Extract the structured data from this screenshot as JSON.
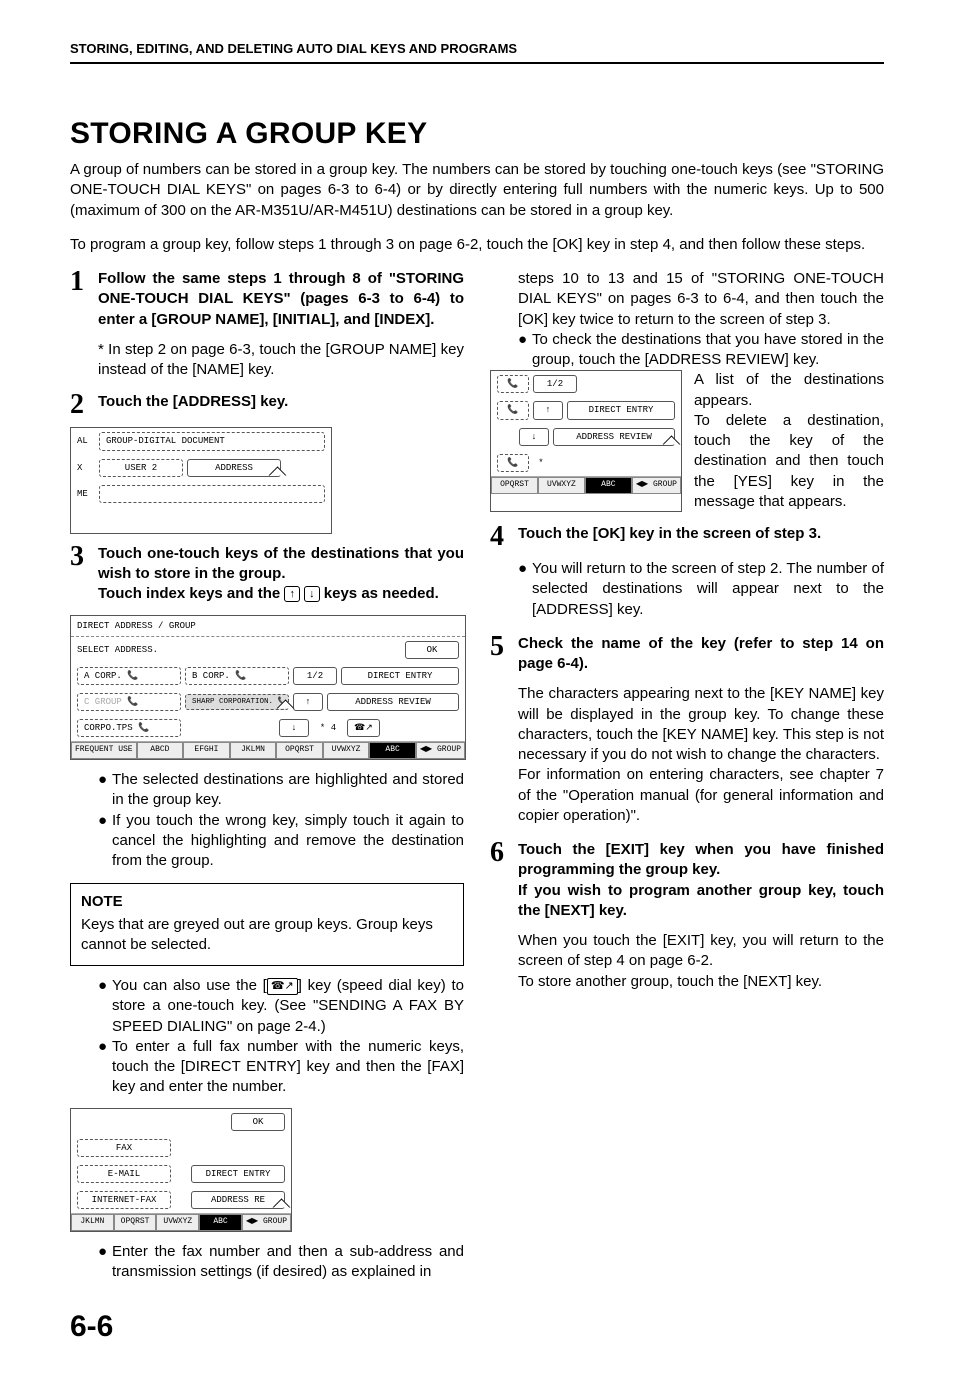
{
  "header": "STORING, EDITING, AND DELETING AUTO DIAL KEYS AND PROGRAMS",
  "title": "STORING A GROUP KEY",
  "intro": "A group of numbers can be stored in a group key. The numbers can be stored by touching one-touch keys (see \"STORING ONE-TOUCH DIAL KEYS\" on pages 6-3 to 6-4) or by directly entering full numbers with the numeric keys. Up to 500 (maximum of 300 on the AR-M351U/AR-M451U) destinations can be stored in a group key.",
  "intro2": "To program a group key, follow steps 1 through 3 on page 6-2, touch the [OK] key in step 4, and then follow these steps.",
  "step1": {
    "head": "Follow the same steps 1 through 8 of \"STORING ONE-TOUCH DIAL KEYS\" (pages 6-3 to 6-4) to enter a [GROUP NAME], [INITIAL], and [INDEX].",
    "sub": "* In step 2 on page 6-3, touch the [GROUP NAME] key instead of the [NAME] key."
  },
  "step2": {
    "head": "Touch the [ADDRESS] key.",
    "screen": {
      "row1_label": "AL",
      "row1_val": "GROUP-DIGITAL DOCUMENT",
      "row2_label": "X",
      "row2_a": "USER 2",
      "row2_b": "ADDRESS",
      "row3_label": "ME"
    }
  },
  "step3": {
    "head1": "Touch one-touch keys of the destinations that you wish to store in the group.",
    "head2_a": "Touch index keys and the ",
    "head2_b": " keys as needed.",
    "screen": {
      "top": "DIRECT ADDRESS / GROUP",
      "select": "SELECT ADDRESS.",
      "ok": "OK",
      "a_corp": "A CORP.",
      "b_corp": "B CORP.",
      "page": "1/2",
      "direct_entry": "DIRECT ENTRY",
      "c_group": "C GROUP",
      "sharp": "SHARP CORPORATION.",
      "address_review": "ADDRESS REVIEW",
      "corpo": "CORPO.TPS",
      "star4": "*  4",
      "tabs": [
        "FREQUENT USE",
        "ABCD",
        "EFGHI",
        "JKLMN",
        "OPQRST",
        "UVWXYZ",
        "ABC",
        "GROUP"
      ]
    },
    "b1": "The selected destinations are highlighted and stored in the group key.",
    "b2": "If you touch the wrong key, simply touch it again to cancel the highlighting and remove the destination from the group."
  },
  "note": {
    "title": "NOTE",
    "body": "Keys that are greyed out are group keys. Group keys cannot be selected.",
    "b1_a": "You can also use the [",
    "b1_b": "] key (speed dial key) to store a one-touch key. (See \"SENDING A FAX BY SPEED DIALING\" on page 2-4.)",
    "b2": "To enter a full fax number with the numeric keys, touch the [DIRECT ENTRY] key and then the [FAX] key and enter the number.",
    "screen": {
      "ok": "OK",
      "fax": "FAX",
      "email": "E-MAIL",
      "direct_entry": "DIRECT ENTRY",
      "ifax": "INTERNET-FAX",
      "address_re": "ADDRESS RE",
      "tabs": [
        "JKLMN",
        "OPQRST",
        "UVWXYZ",
        "ABC",
        "GROUP"
      ]
    },
    "b3": "Enter the fax number and then a sub-address and transmission settings (if desired) as explained in"
  },
  "right": {
    "cont1": "steps 10 to 13 and 15 of \"STORING ONE-TOUCH DIAL KEYS\" on pages 6-3 to 6-4, and then touch the [OK] key twice to return to the screen of step 3.",
    "cont2": "To check the destinations that you have stored in the group, touch the [ADDRESS REVIEW] key.",
    "fig": {
      "page": "1/2",
      "direct_entry": "DIRECT ENTRY",
      "address_review": "ADDRESS REVIEW",
      "tabs": [
        "OPQRST",
        "UVWXYZ",
        "ABC",
        "GROUP"
      ]
    },
    "figtext1": "A list of the destinations appears.",
    "figtext2": "To delete a destination, touch the key of the destination and then touch the [YES] key in the message that appears."
  },
  "step4": {
    "head": "Touch the [OK] key in the screen of step 3.",
    "b1": "You will return to the screen of step 2. The number of selected destinations will appear next to the [ADDRESS] key."
  },
  "step5": {
    "head": "Check the name of the key (refer to step 14 on page 6-4).",
    "p1": "The characters appearing next to the [KEY NAME] key will be displayed in the group key. To change these characters, touch the [KEY NAME] key. This step is not necessary if you do not wish to change the characters.",
    "p2": "For information on entering characters, see chapter 7 of the \"Operation manual (for general information and copier operation)\"."
  },
  "step6": {
    "head": "Touch the [EXIT] key when you have finished programming the group key.\nIf you wish to program another group key, touch the [NEXT] key.",
    "p1": "When you touch the [EXIT] key, you will return to the screen of step 4 on page 6-2.",
    "p2": "To store another group, touch the [NEXT] key."
  },
  "pagenum": "6-6"
}
